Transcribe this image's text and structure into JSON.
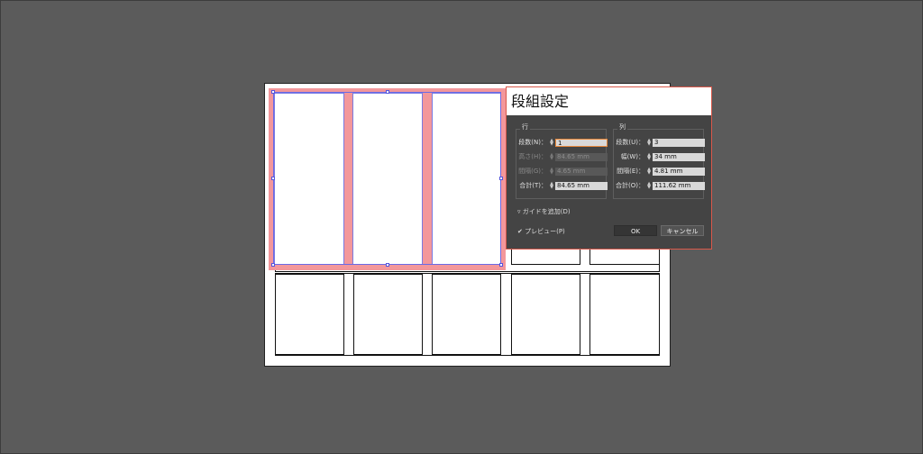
{
  "dialog": {
    "title": "段組設定",
    "rows_group": {
      "label": "行",
      "fields": [
        {
          "label": "段数(N)：",
          "value": "1",
          "enabled": true,
          "focused": true
        },
        {
          "label": "高さ(H)：",
          "value": "84.65 mm",
          "enabled": false
        },
        {
          "label": "間隔(G)：",
          "value": "4.65 mm",
          "enabled": false
        },
        {
          "label": "合計(T)：",
          "value": "84.65 mm",
          "enabled": true
        }
      ]
    },
    "cols_group": {
      "label": "列",
      "fields": [
        {
          "label": "段数(U)：",
          "value": "3",
          "enabled": true
        },
        {
          "label": "幅(W)：",
          "value": "34 mm",
          "enabled": true
        },
        {
          "label": "間隔(E)：",
          "value": "4.81 mm",
          "enabled": true
        },
        {
          "label": "合計(O)：",
          "value": "111.62 mm",
          "enabled": true
        }
      ]
    },
    "add_guides": "ガイドを追加(D)",
    "add_guides_marker": "▿",
    "preview": "プレビュー(P)",
    "preview_check": "✔",
    "ok": "OK",
    "cancel": "キャンセル"
  },
  "colors": {
    "workspace": "#5b5b5b",
    "selection_fill": "#f3979b",
    "selection_stroke": "#6a6ae6",
    "dialog_border": "#d8584a",
    "dialog_bg": "#444444"
  }
}
